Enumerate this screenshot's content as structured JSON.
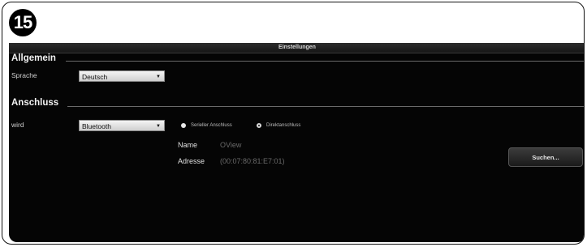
{
  "step": "15",
  "window": {
    "title": "Einstellungen"
  },
  "general": {
    "heading": "Allgemein",
    "language_label": "Sprache",
    "language_value": "Deutsch"
  },
  "connection": {
    "heading": "Anschluss",
    "type_label": "wird",
    "type_value": "Bluetooth",
    "radio_options": [
      "Serieller Anschluss",
      "Direktanschluss"
    ],
    "selected_radio": "Direktanschluss",
    "name_label": "Name",
    "name_value": "OView",
    "address_label": "Adresse",
    "address_value": "(00:07:80:81:E7:01)",
    "search_button": "Suchen..."
  },
  "icons": {
    "dropdown_arrow": "chevron-down-icon"
  }
}
